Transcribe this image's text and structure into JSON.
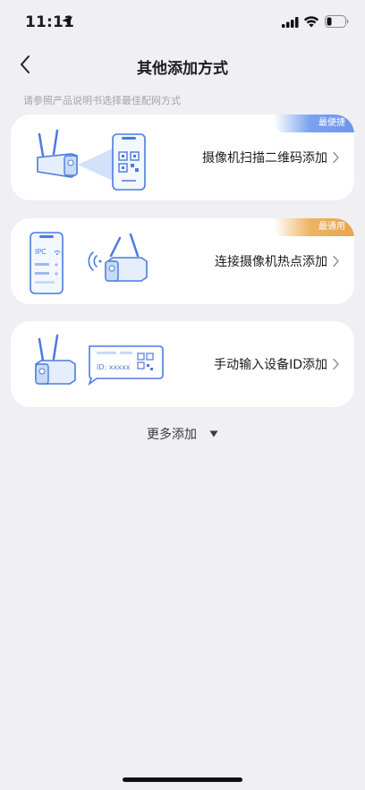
{
  "status_bar": {
    "time": "11:11"
  },
  "nav": {
    "title": "其他添加方式"
  },
  "hint": "请参照产品说明书选择最佳配网方式",
  "cards": [
    {
      "label": "摄像机扫描二维码添加",
      "badge": "最便捷",
      "badge_color": "#6E96EA"
    },
    {
      "label": "连接摄像机热点添加",
      "badge": "最通用",
      "badge_color": "#E9A44D",
      "phone_text": "IPC"
    },
    {
      "label": "手动输入设备ID添加",
      "bubble_text": "ID: xxxxx"
    }
  ],
  "more": {
    "label": "更多添加"
  },
  "colors": {
    "accent": "#4A7BE0",
    "background": "#EFEFF4"
  }
}
